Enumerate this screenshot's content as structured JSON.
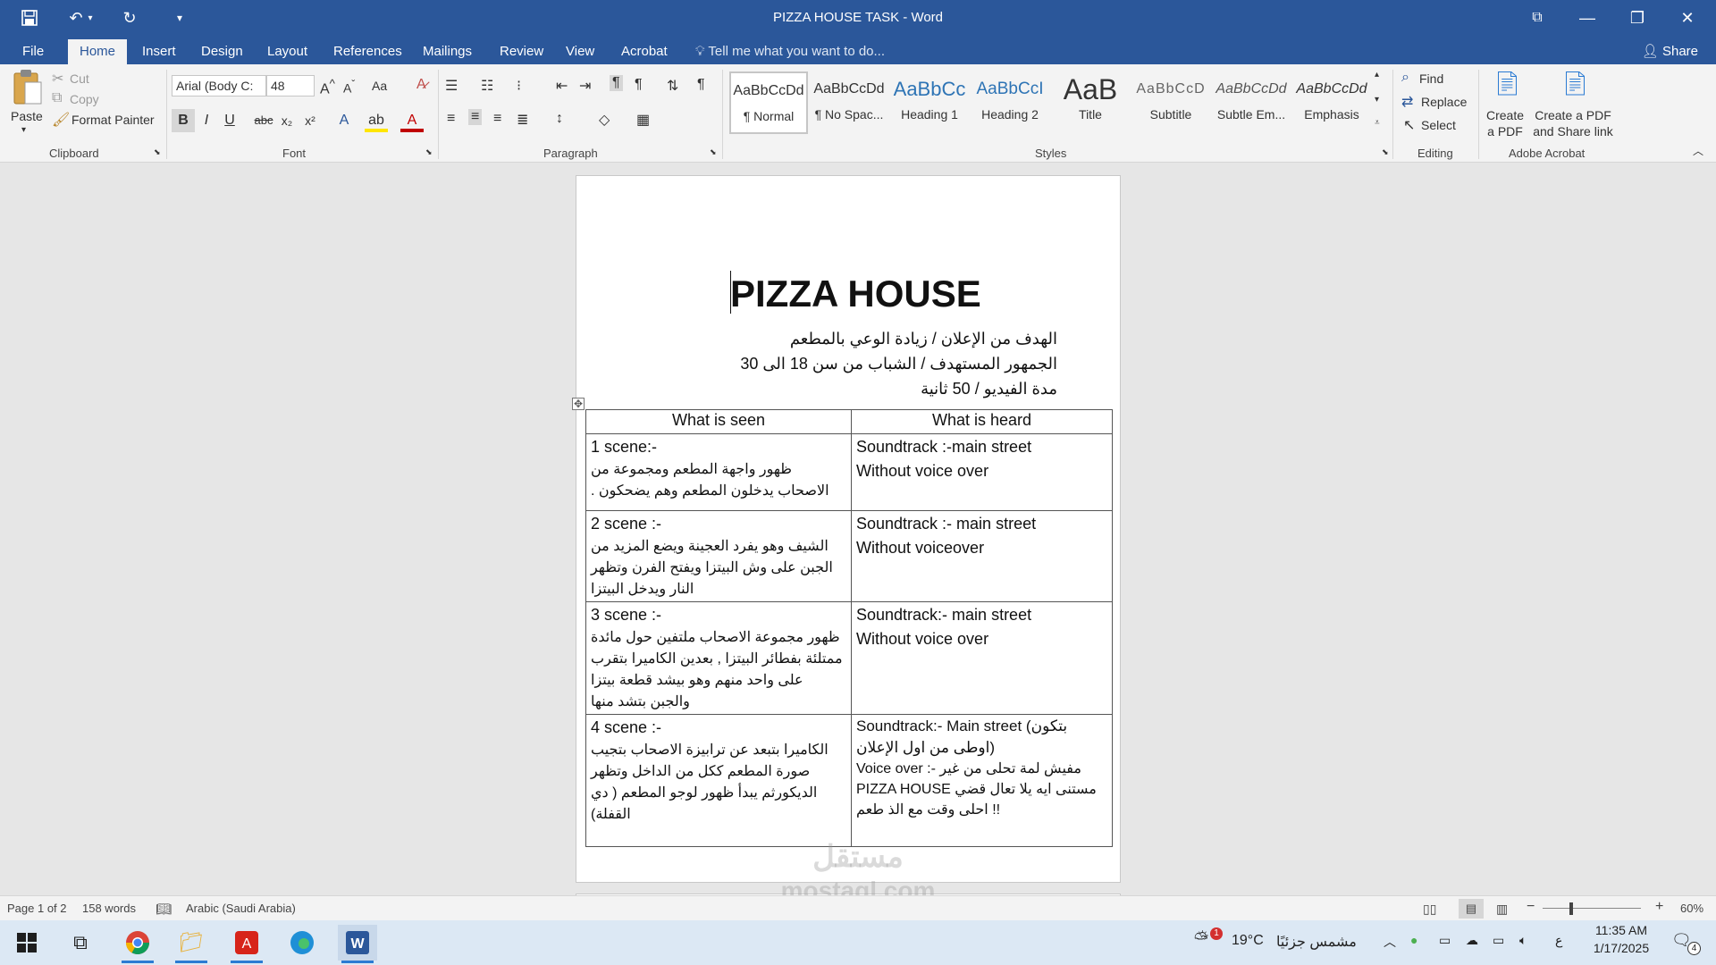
{
  "window": {
    "title": "PIZZA HOUSE TASK - Word",
    "controls": {
      "ribbon_display": "⧉",
      "minimize": "—",
      "restore": "❐",
      "close": "✕"
    }
  },
  "qat": {
    "save_icon": "save-icon",
    "undo_icon": "undo-icon",
    "redo_icon": "redo-icon",
    "customize_icon": "customize-icon"
  },
  "menu": {
    "tabs": [
      "File",
      "Home",
      "Insert",
      "Design",
      "Layout",
      "References",
      "Mailings",
      "Review",
      "View",
      "Acrobat"
    ],
    "active_tab": "Home",
    "tell_me": "Tell me what you want to do...",
    "share": "Share"
  },
  "ribbon": {
    "clipboard": {
      "paste": "Paste",
      "cut": "Cut",
      "copy": "Copy",
      "format_painter": "Format Painter",
      "label": "Clipboard"
    },
    "font": {
      "name": "Arial (Body C:",
      "size": "48",
      "label": "Font",
      "bold": "B",
      "italic": "I",
      "underline": "U",
      "strike": "abc",
      "subscript": "x₂",
      "superscript": "x²",
      "change_case": "Aa"
    },
    "paragraph": {
      "label": "Paragraph"
    },
    "styles": {
      "label": "Styles",
      "items": [
        {
          "preview": "AaBbCcDd",
          "name": "¶ Normal"
        },
        {
          "preview": "AaBbCcDd",
          "name": "¶ No Spac..."
        },
        {
          "preview": "AaBbCc",
          "name": "Heading 1"
        },
        {
          "preview": "AaBbCcI",
          "name": "Heading 2"
        },
        {
          "preview": "AaB",
          "name": "Title"
        },
        {
          "preview": "AaBbCcD",
          "name": "Subtitle"
        },
        {
          "preview": "AaBbCcDd",
          "name": "Subtle Em..."
        },
        {
          "preview": "AaBbCcDd",
          "name": "Emphasis"
        }
      ]
    },
    "editing": {
      "find": "Find",
      "replace": "Replace",
      "select": "Select",
      "label": "Editing"
    },
    "acrobat": {
      "create_pdf": "Create a PDF",
      "create_share": "Create a PDF and Share link",
      "label": "Adobe Acrobat"
    }
  },
  "document": {
    "heading": "PIZZA HOUSE",
    "lines": [
      "الهدف من الإعلان / زيادة الوعي بالمطعم",
      "الجمهور المستهدف / الشباب من سن 18 الى 30",
      "مدة الفيديو / 50 ثانية"
    ],
    "table": {
      "headers": [
        "What is seen",
        "What is heard"
      ],
      "rows": [
        {
          "seen_label": "1 scene:-",
          "seen_text": "ظهور واجهة المطعم ومجموعة من الاصحاب يدخلون المطعم وهم يضحكون .",
          "heard_lines": [
            "Soundtrack :-main street",
            "Without voice over"
          ]
        },
        {
          "seen_label": "2 scene :-",
          "seen_text": "الشيف وهو يفرد العجينة ويضع المزيد من الجبن على وش البيتزا ويفتح الفرن وتظهر النار ويدخل البيتزا",
          "heard_lines": [
            "Soundtrack :- main street",
            "Without voiceover"
          ]
        },
        {
          "seen_label": "3 scene :-",
          "seen_text": "ظهور مجموعة الاصحاب ملتفين حول مائدة ممتلئة بفطائر البيتزا , بعدين الكاميرا بتقرب على واحد منهم وهو بيشد قطعة بيتزا والجبن بتشد منها",
          "heard_lines": [
            "Soundtrack:- main street",
            "Without voice over"
          ]
        },
        {
          "seen_label": "4 scene :-",
          "seen_text": "الكاميرا بتبعد عن ترابيزة الاصحاب بتجيب صورة المطعم ككل من الداخل وتظهر الديكورثم يبدأ ظهور لوجو المطعم ( دي القفلة)",
          "heard_lines": [
            "Soundtrack:- Main street (بتكون اوطى من اول الإعلان)",
            "Voice over :- مفيش لمة تحلى من غير PIZZA HOUSE مستنى ايه يلا تعال قضي احلى وقت مع الذ طعم !!"
          ]
        }
      ]
    }
  },
  "status": {
    "page": "Page 1 of 2",
    "words": "158 words",
    "language": "Arabic (Saudi Arabia)",
    "zoom": "60%"
  },
  "taskbar": {
    "weather_temp": "19°C",
    "weather_text": "مشمس جزئيًا",
    "weather_badge": "1",
    "lang": "ع",
    "time": "11:35 AM",
    "date": "1/17/2025",
    "notifications": "4"
  },
  "watermark": {
    "logo": "مستقل",
    "domain": "mostaql.com"
  }
}
